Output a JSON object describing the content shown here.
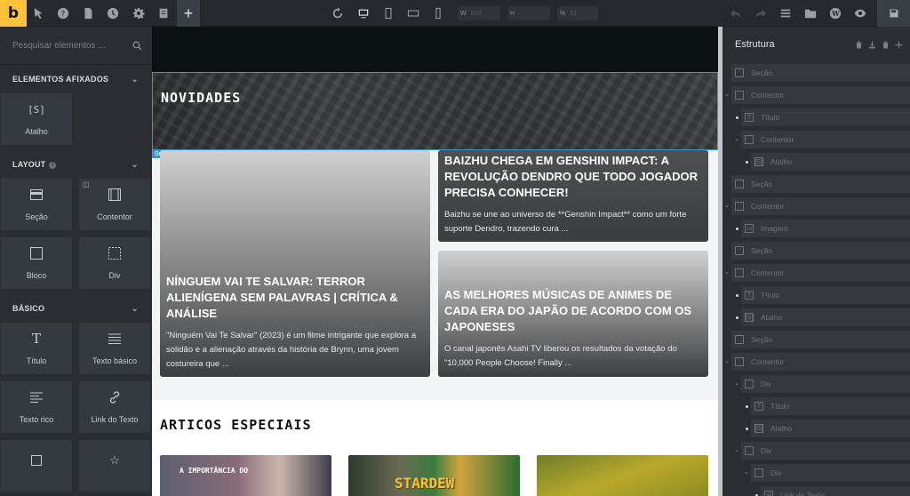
{
  "toolbar": {
    "logo": "b",
    "width_label": "W",
    "width_value": "850",
    "height_label": "H",
    "height_value": "-",
    "zoom_label": "%",
    "zoom_value": "91"
  },
  "left_panel": {
    "search_placeholder": "Pesquisar elementos ...",
    "sections": [
      {
        "title": "ELEMENTOS AFIXADOS",
        "items": [
          {
            "icon": "shortcode-icon",
            "glyph": "[S]",
            "label": "Atalho"
          }
        ]
      },
      {
        "title": "LAYOUT",
        "items": [
          {
            "icon": "section-icon",
            "label": "Seção"
          },
          {
            "icon": "container-icon",
            "label": "Contentor"
          },
          {
            "icon": "block-icon",
            "label": "Bloco"
          },
          {
            "icon": "div-icon",
            "label": "Div"
          }
        ]
      },
      {
        "title": "BÁSICO",
        "items": [
          {
            "icon": "heading-icon",
            "glyph": "T",
            "label": "Título"
          },
          {
            "icon": "text-basic-icon",
            "label": "Texto básico"
          },
          {
            "icon": "rich-text-icon",
            "label": "Texto rico"
          },
          {
            "icon": "link-icon",
            "label": "Link do Texto"
          },
          {
            "icon": "button-icon",
            "label": ""
          },
          {
            "icon": "star-icon",
            "label": ""
          }
        ]
      }
    ]
  },
  "canvas": {
    "hero_title": "NOVIDADES",
    "section_tag": "Seção",
    "cards": [
      {
        "title": "NÍNGUEM VAI TE SALVAR: TERROR ALIENÍGENA SEM PALAVRAS | CRÍTICA & ANÁLISE",
        "description": "\"Ninguém Vai Te Salvar\" (2023) é um filme intrigante que explora a solidão e a alienação através da história de Brynn, uma jovem costureira que ..."
      },
      {
        "title": "BAIZHU CHEGA EM GENSHIN IMPACT: A REVOLUÇÃO DENDRO QUE TODO JOGADOR PRECISA CONHECER!",
        "description": "Baizhu se une ao universo de **Genshin Impact** como um forte suporte Dendro, trazendo cura ..."
      },
      {
        "title": "AS MELHORES MÚSICAS DE ANIMES DE CADA ERA DO JAPÃO DE ACORDO COM OS JAPONESES",
        "description": "O canal japonês Asahi TV liberou os resultados da votação do \"10,000 People Choose! Finally ..."
      }
    ],
    "specials_title": "ARTICOS ESPECIAIS",
    "thumb_captions": [
      "A IMPORTÂNCIA DO",
      "STARDEW"
    ]
  },
  "right_panel": {
    "title": "Estrutura",
    "tree": [
      {
        "depth": 0,
        "icon": "section",
        "label": "Seção",
        "toggle": false
      },
      {
        "depth": 0,
        "icon": "container",
        "label": "Contentor",
        "toggle": true
      },
      {
        "depth": 1,
        "icon": "heading",
        "label": "Título",
        "toggle": false
      },
      {
        "depth": 1,
        "icon": "container",
        "label": "Contentor",
        "toggle": true
      },
      {
        "depth": 2,
        "icon": "shortcode",
        "label": "Atalho",
        "toggle": false
      },
      {
        "depth": 0,
        "icon": "section",
        "label": "Seção",
        "toggle": false
      },
      {
        "depth": 0,
        "icon": "container",
        "label": "Contentor",
        "toggle": true
      },
      {
        "depth": 1,
        "icon": "image",
        "label": "Imagem",
        "toggle": false
      },
      {
        "depth": 0,
        "icon": "section",
        "label": "Seção",
        "toggle": false
      },
      {
        "depth": 0,
        "icon": "container",
        "label": "Contentor",
        "toggle": true
      },
      {
        "depth": 1,
        "icon": "heading",
        "label": "Título",
        "toggle": false
      },
      {
        "depth": 1,
        "icon": "shortcode",
        "label": "Atalho",
        "toggle": false
      },
      {
        "depth": 0,
        "icon": "section",
        "label": "Seção",
        "toggle": false
      },
      {
        "depth": 0,
        "icon": "container",
        "label": "Contentor",
        "toggle": true
      },
      {
        "depth": 1,
        "icon": "div",
        "label": "Div",
        "toggle": true
      },
      {
        "depth": 2,
        "icon": "heading",
        "label": "Título",
        "toggle": false
      },
      {
        "depth": 2,
        "icon": "shortcode",
        "label": "Atalho",
        "toggle": false
      },
      {
        "depth": 1,
        "icon": "div",
        "label": "Div",
        "toggle": true
      },
      {
        "depth": 2,
        "icon": "div",
        "label": "Div",
        "toggle": true
      },
      {
        "depth": 3,
        "icon": "link",
        "label": "Link do Texto",
        "toggle": false
      }
    ]
  },
  "colors": {
    "accent": "#ffc23a",
    "selection": "#2f9ad6"
  }
}
